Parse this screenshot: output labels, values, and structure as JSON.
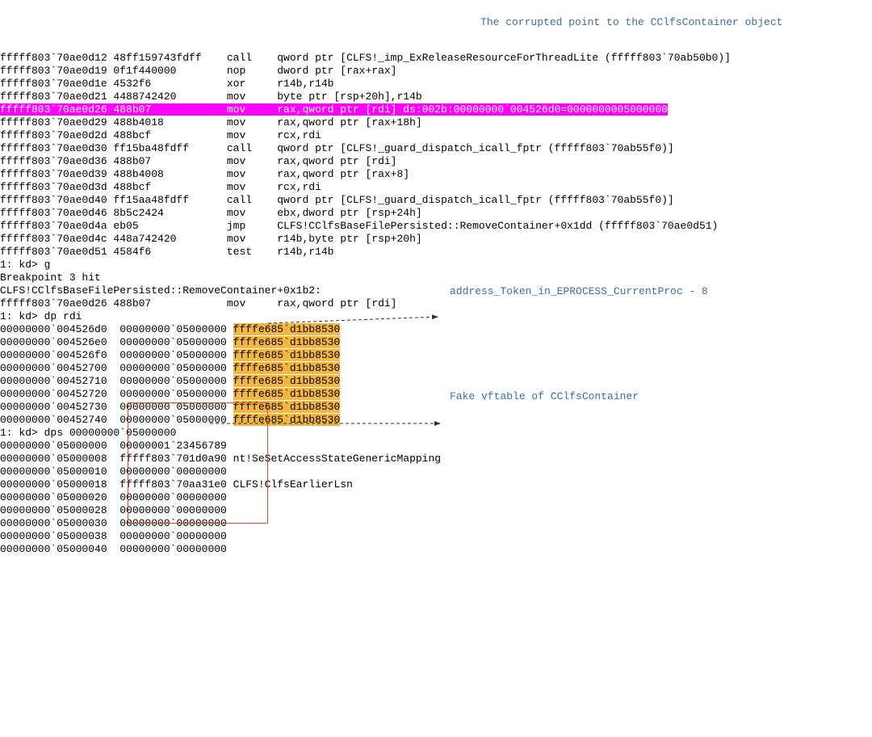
{
  "annot": {
    "corrupted": "The corrupted point to the CClfsContainer object",
    "addr_token": "address_Token_in_EPROCESS_CurrentProc - 8",
    "fake_vft": "Fake vftable of CClfsContainer"
  },
  "disasm": [
    {
      "a": "fffff803`70ae0d12",
      "b": "48ff159743fdff",
      "o": "call",
      "x": "qword ptr [CLFS!_imp_ExReleaseResourceForThreadLite (fffff803`70ab50b0)]"
    },
    {
      "a": "fffff803`70ae0d19",
      "b": "0f1f440000",
      "o": "nop",
      "x": "dword ptr [rax+rax]"
    },
    {
      "a": "fffff803`70ae0d1e",
      "b": "4532f6",
      "o": "xor",
      "x": "r14b,r14b"
    },
    {
      "a": "fffff803`70ae0d21",
      "b": "4488742420",
      "o": "mov",
      "x": "byte ptr [rsp+20h],r14b"
    },
    {
      "a": "fffff803`70ae0d26",
      "b": "488b07",
      "o": "mov",
      "x": "rax,qword ptr [rdi] ds:002b:00000000`004526d0=0000000005000000",
      "hl": "magenta"
    },
    {
      "a": "fffff803`70ae0d29",
      "b": "488b4018",
      "o": "mov",
      "x": "rax,qword ptr [rax+18h]"
    },
    {
      "a": "fffff803`70ae0d2d",
      "b": "488bcf",
      "o": "mov",
      "x": "rcx,rdi"
    },
    {
      "a": "fffff803`70ae0d30",
      "b": "ff15ba48fdff",
      "o": "call",
      "x": "qword ptr [CLFS!_guard_dispatch_icall_fptr (fffff803`70ab55f0)]"
    },
    {
      "a": "fffff803`70ae0d36",
      "b": "488b07",
      "o": "mov",
      "x": "rax,qword ptr [rdi]"
    },
    {
      "a": "fffff803`70ae0d39",
      "b": "488b4008",
      "o": "mov",
      "x": "rax,qword ptr [rax+8]"
    },
    {
      "a": "fffff803`70ae0d3d",
      "b": "488bcf",
      "o": "mov",
      "x": "rcx,rdi"
    },
    {
      "a": "fffff803`70ae0d40",
      "b": "ff15aa48fdff",
      "o": "call",
      "x": "qword ptr [CLFS!_guard_dispatch_icall_fptr (fffff803`70ab55f0)]"
    },
    {
      "a": "fffff803`70ae0d46",
      "b": "8b5c2424",
      "o": "mov",
      "x": "ebx,dword ptr [rsp+24h]"
    },
    {
      "a": "fffff803`70ae0d4a",
      "b": "eb05",
      "o": "jmp",
      "x": "CLFS!CClfsBaseFilePersisted::RemoveContainer+0x1dd (fffff803`70ae0d51)"
    },
    {
      "a": "fffff803`70ae0d4c",
      "b": "448a742420",
      "o": "mov",
      "x": "r14b,byte ptr [rsp+20h]"
    },
    {
      "a": "fffff803`70ae0d51",
      "b": "4584f6",
      "o": "test",
      "x": "r14b,r14b"
    }
  ],
  "mid": [
    "1: kd> g",
    "Breakpoint 3 hit",
    "CLFS!CClfsBaseFilePersisted::RemoveContainer+0x1b2:"
  ],
  "mid_disasm": {
    "a": "fffff803`70ae0d26",
    "b": "488b07",
    "o": "mov",
    "x": "rax,qword ptr [rdi]"
  },
  "cmd_dp": "1: kd> dp rdi",
  "dp_rows": [
    {
      "a": "00000000`004526d0",
      "c1": "00000000`05000000",
      "c2": "ffffe685`d1bb8530"
    },
    {
      "a": "00000000`004526e0",
      "c1": "00000000`05000000",
      "c2": "ffffe685`d1bb8530"
    },
    {
      "a": "00000000`004526f0",
      "c1": "00000000`05000000",
      "c2": "ffffe685`d1bb8530"
    },
    {
      "a": "00000000`00452700",
      "c1": "00000000`05000000",
      "c2": "ffffe685`d1bb8530"
    },
    {
      "a": "00000000`00452710",
      "c1": "00000000`05000000",
      "c2": "ffffe685`d1bb8530"
    },
    {
      "a": "00000000`00452720",
      "c1": "00000000`05000000",
      "c2": "ffffe685`d1bb8530"
    },
    {
      "a": "00000000`00452730",
      "c1": "00000000`05000000",
      "c2": "ffffe685`d1bb8530"
    },
    {
      "a": "00000000`00452740",
      "c1": "00000000`05000000",
      "c2": "ffffe685`d1bb8530"
    }
  ],
  "cmd_dps": "1: kd> dps 00000000`05000000",
  "dps_rows": [
    {
      "a": "00000000`05000000",
      "v": "00000001`23456789",
      "s": ""
    },
    {
      "a": "00000000`05000008",
      "v": "fffff803`701d0a90",
      "s": "nt!SeSetAccessStateGenericMapping"
    },
    {
      "a": "00000000`05000010",
      "v": "00000000`00000000",
      "s": ""
    },
    {
      "a": "00000000`05000018",
      "v": "fffff803`70aa31e0",
      "s": "CLFS!ClfsEarlierLsn"
    },
    {
      "a": "00000000`05000020",
      "v": "00000000`00000000",
      "s": ""
    },
    {
      "a": "00000000`05000028",
      "v": "00000000`00000000",
      "s": ""
    },
    {
      "a": "00000000`05000030",
      "v": "00000000`00000000",
      "s": ""
    },
    {
      "a": "00000000`05000038",
      "v": "00000000`00000000",
      "s": ""
    },
    {
      "a": "00000000`05000040",
      "v": "00000000`00000000",
      "s": ""
    }
  ]
}
